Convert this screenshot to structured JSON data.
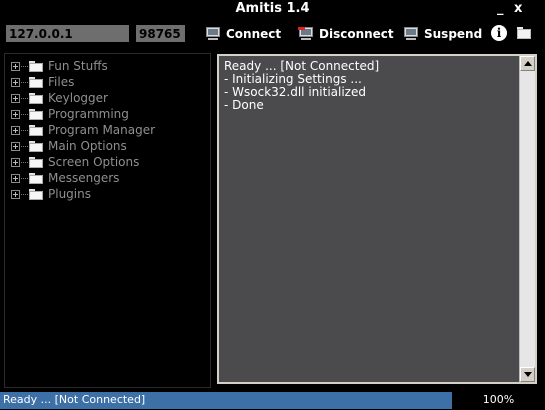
{
  "window": {
    "title": "Amitis 1.4",
    "minimize_label": "_",
    "close_label": "x"
  },
  "toolbar": {
    "ip_value": "127.0.0.1",
    "port_value": "98765",
    "connect_label": "Connect",
    "disconnect_label": "Disconnect",
    "suspend_label": "Suspend",
    "info_icon": "info-icon",
    "folder_icon": "folder-icon",
    "info_glyph": "i"
  },
  "tree": {
    "items": [
      {
        "label": "Fun Stuffs"
      },
      {
        "label": "Files"
      },
      {
        "label": "Keylogger"
      },
      {
        "label": "Programming"
      },
      {
        "label": "Program Manager"
      },
      {
        "label": "Main Options"
      },
      {
        "label": "Screen Options"
      },
      {
        "label": "Messengers"
      },
      {
        "label": "Plugins"
      }
    ]
  },
  "log": {
    "lines": [
      "Ready ... [Not Connected]",
      "- Initializing Settings ...",
      "- Wsock32.dll initialized",
      "- Done"
    ]
  },
  "status": {
    "text": "Ready ... [Not Connected]",
    "percent_label": "100%",
    "progress_fraction": 1.0
  },
  "colors": {
    "accent": "#3c70a6",
    "log_background": "#4b4a4d",
    "field_background": "#6e6e6e",
    "tree_text": "#8f8f8f"
  }
}
